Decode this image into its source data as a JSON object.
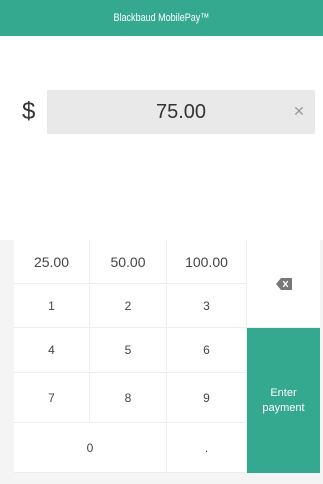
{
  "header": {
    "title": "Blackbaud MobilePay™"
  },
  "amount": {
    "currency": "$",
    "value": "75.00"
  },
  "quick_amounts": [
    "25.00",
    "50.00",
    "100.00"
  ],
  "digits": [
    "1",
    "2",
    "3",
    "4",
    "5",
    "6",
    "7",
    "8",
    "9",
    "0",
    "."
  ],
  "actions": {
    "enter_label": "Enter payment"
  },
  "icons": {
    "clear": "close-icon",
    "backspace": "backspace-icon"
  },
  "colors": {
    "accent": "#35a98f",
    "amount_bg": "#e9e9e9"
  }
}
